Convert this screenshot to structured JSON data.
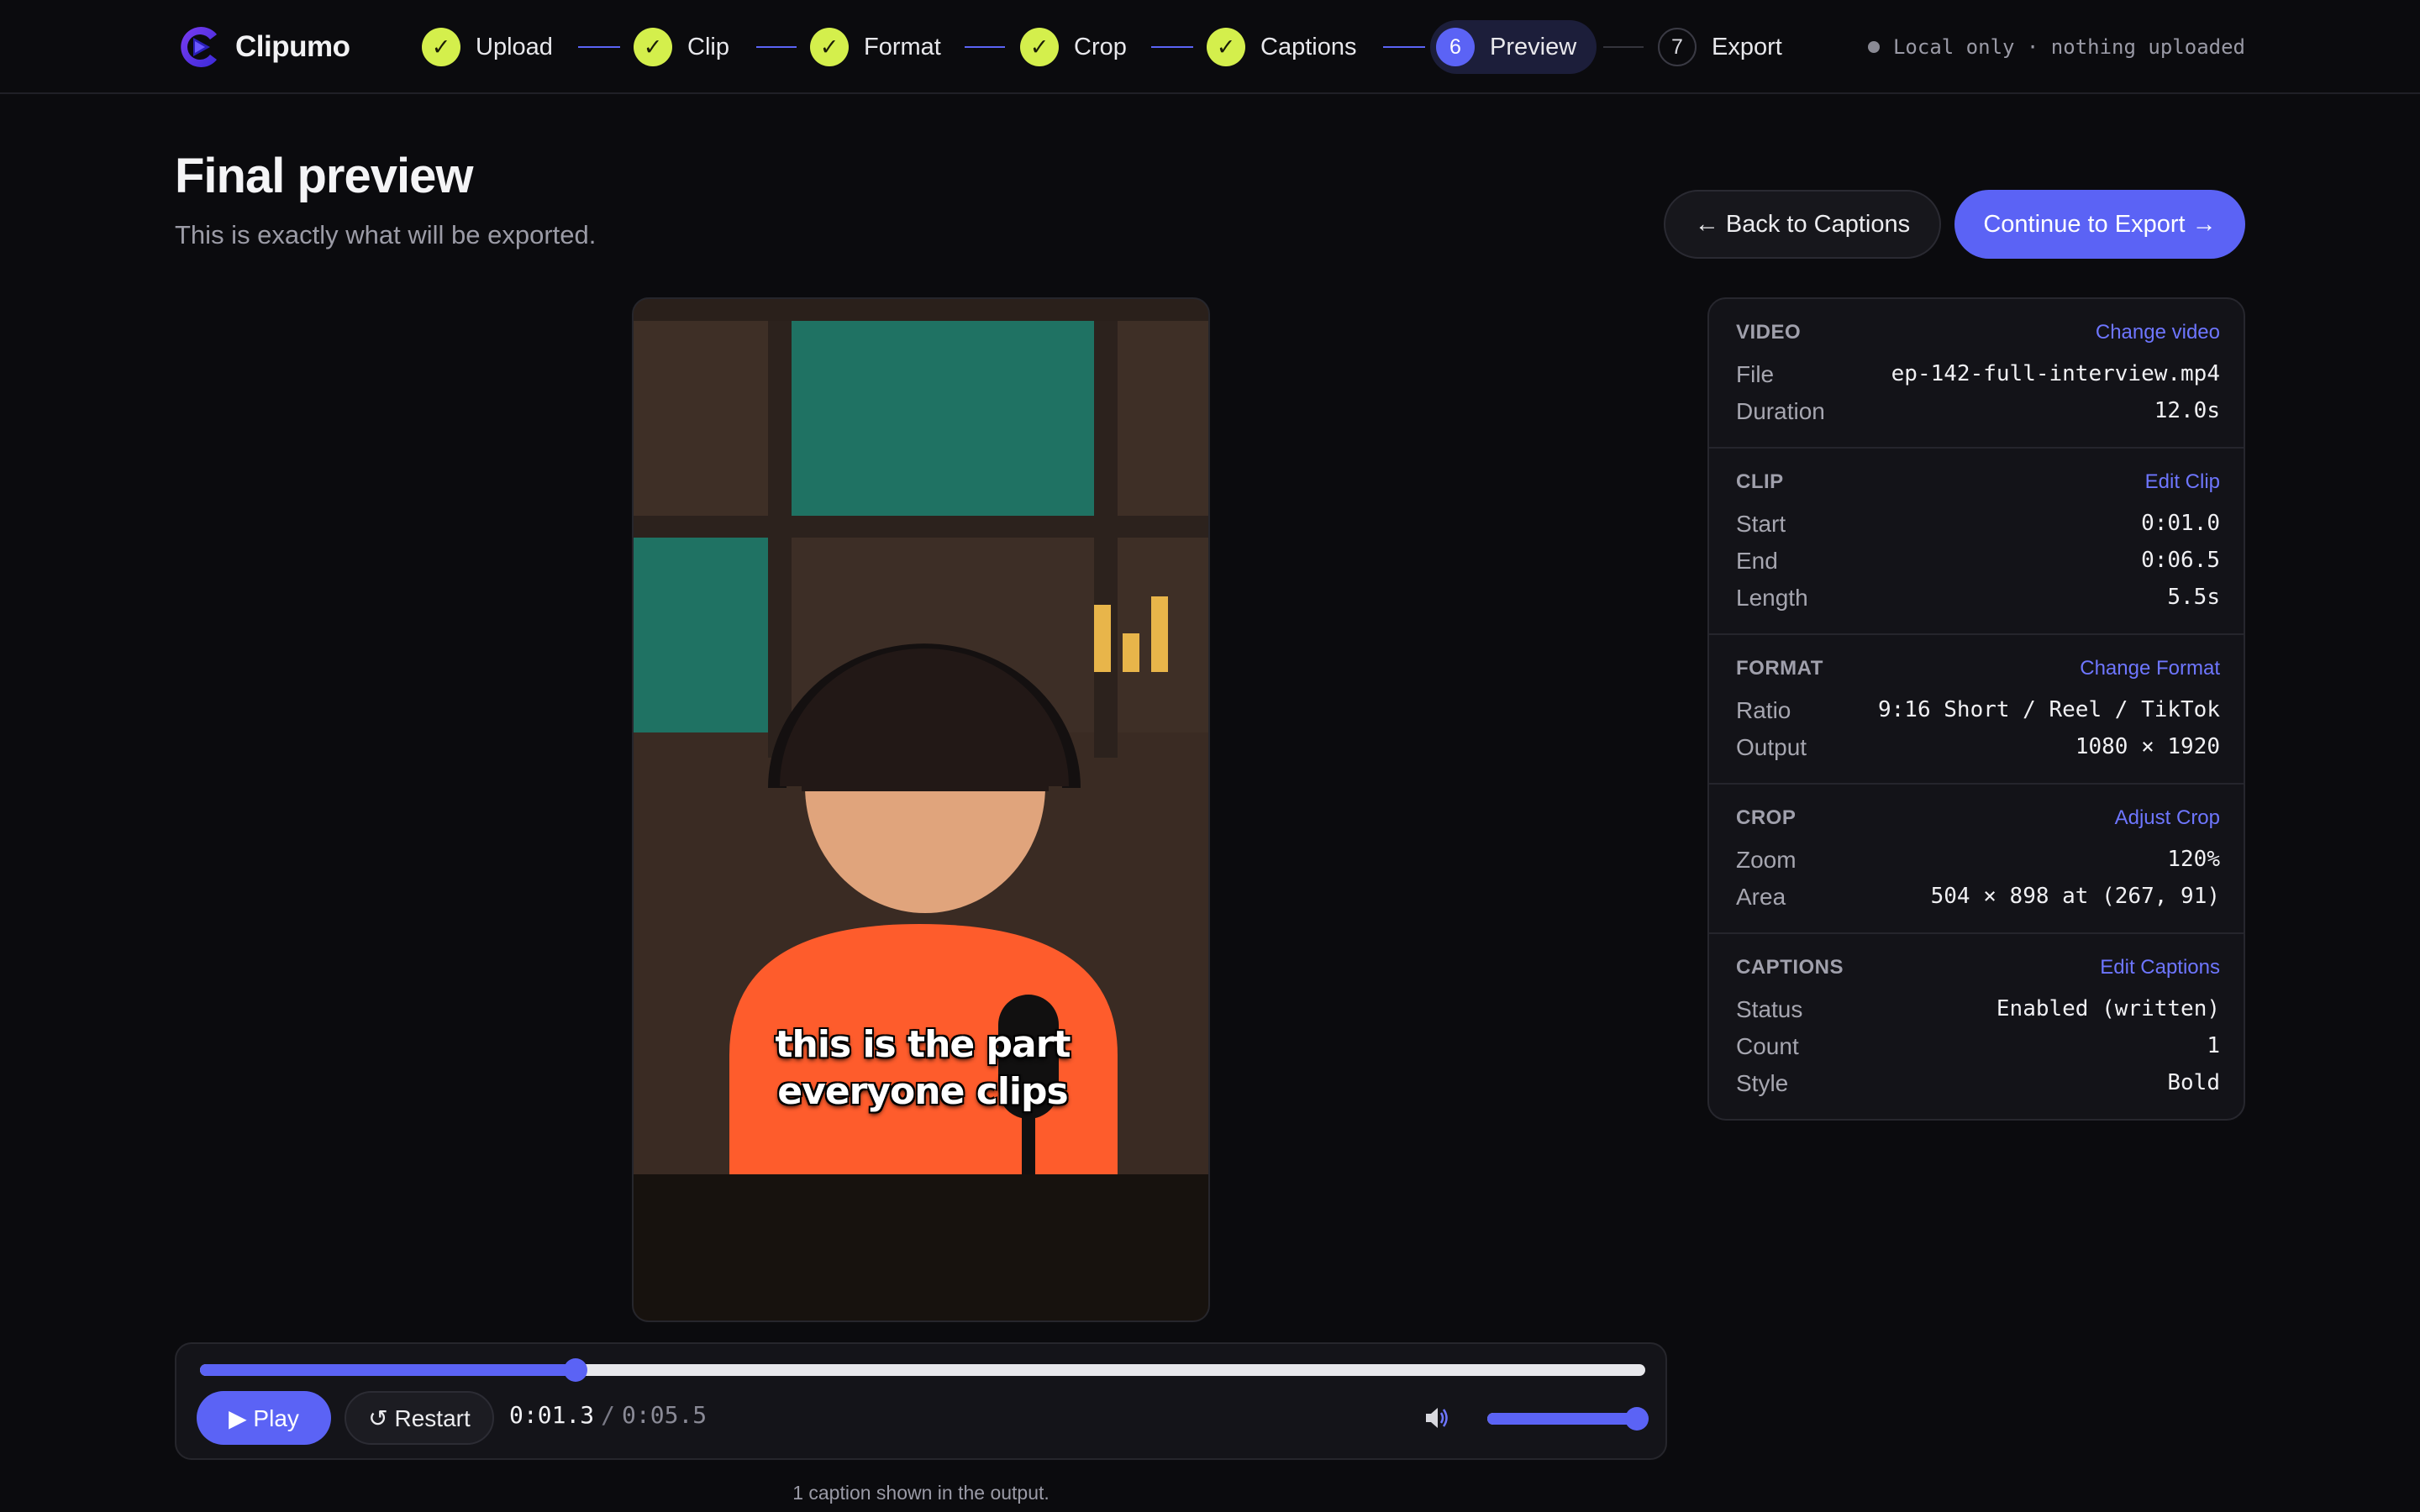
{
  "app": {
    "name": "Clipumo"
  },
  "steps": [
    {
      "label": "Upload",
      "state": "done",
      "mark": "✓"
    },
    {
      "label": "Clip",
      "state": "done",
      "mark": "✓"
    },
    {
      "label": "Format",
      "state": "done",
      "mark": "✓"
    },
    {
      "label": "Crop",
      "state": "done",
      "mark": "✓"
    },
    {
      "label": "Captions",
      "state": "done",
      "mark": "✓"
    },
    {
      "label": "Preview",
      "state": "current",
      "mark": "6"
    },
    {
      "label": "Export",
      "state": "pending",
      "mark": "7"
    }
  ],
  "status": {
    "text": "Local only · nothing uploaded"
  },
  "page": {
    "title": "Final preview",
    "subtitle": "This is exactly what will be exported."
  },
  "actions": {
    "back_label": "← Back to Captions",
    "continue_label": "Continue to Export →"
  },
  "preview": {
    "caption_text": "this is the part everyone clips"
  },
  "player": {
    "play_label": "▶ Play",
    "restart_label": "↺ Restart",
    "current_time": "0:01.3",
    "separator": "/",
    "total_time": "0:05.5",
    "progress_fraction": 0.26,
    "volume_fraction": 1.0
  },
  "footnote": "1 caption shown in the output.",
  "summary": {
    "video": {
      "heading": "VIDEO",
      "link": "Change video",
      "rows": [
        {
          "label": "File",
          "value": "ep-142-full-interview.mp4"
        },
        {
          "label": "Duration",
          "value": "12.0s"
        }
      ]
    },
    "clip": {
      "heading": "CLIP",
      "link": "Edit Clip",
      "rows": [
        {
          "label": "Start",
          "value": "0:01.0"
        },
        {
          "label": "End",
          "value": "0:06.5"
        },
        {
          "label": "Length",
          "value": "5.5s"
        }
      ]
    },
    "format": {
      "heading": "FORMAT",
      "link": "Change Format",
      "rows": [
        {
          "label": "Ratio",
          "value": "9:16 Short / Reel / TikTok"
        },
        {
          "label": "Output",
          "value": "1080 × 1920"
        }
      ]
    },
    "crop": {
      "heading": "CROP",
      "link": "Adjust Crop",
      "rows": [
        {
          "label": "Zoom",
          "value": "120%"
        },
        {
          "label": "Area",
          "value": "504 × 898 at (267, 91)"
        }
      ]
    },
    "captions": {
      "heading": "CAPTIONS",
      "link": "Edit Captions",
      "rows": [
        {
          "label": "Status",
          "value": "Enabled (written)"
        },
        {
          "label": "Count",
          "value": "1"
        },
        {
          "label": "Style",
          "value": "Bold"
        }
      ]
    }
  },
  "colors": {
    "accent": "#5b63f5",
    "done": "#d4ef4c",
    "background": "#0b0b0e",
    "link": "#6e76ff"
  }
}
